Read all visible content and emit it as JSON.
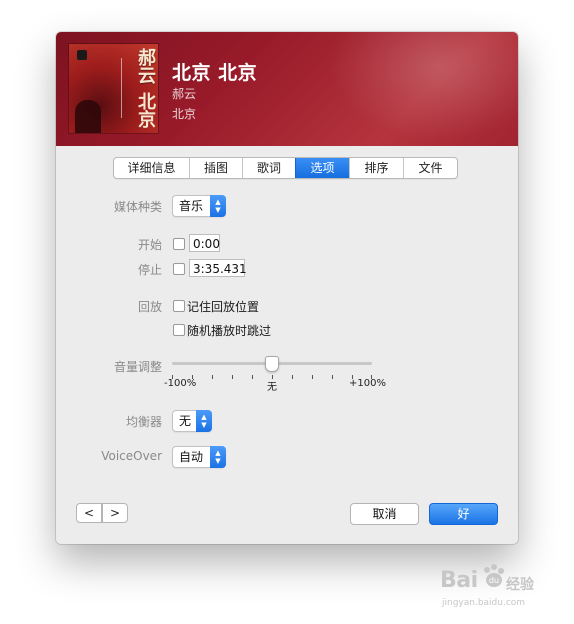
{
  "header": {
    "title": "北京 北京",
    "artist": "郝云",
    "album": "北京",
    "album_art": {
      "title_line1": "郝云",
      "title_line2": "北京"
    }
  },
  "tabs": [
    {
      "label": "详细信息",
      "active": false
    },
    {
      "label": "插图",
      "active": false
    },
    {
      "label": "歌词",
      "active": false
    },
    {
      "label": "选项",
      "active": true
    },
    {
      "label": "排序",
      "active": false
    },
    {
      "label": "文件",
      "active": false
    }
  ],
  "options": {
    "media_kind_label": "媒体种类",
    "media_kind_value": "音乐",
    "start_label": "开始",
    "start_checked": false,
    "start_value": "0:00",
    "stop_label": "停止",
    "stop_checked": false,
    "stop_value": "3:35.431",
    "playback_label": "回放",
    "remember_position_label": "记住回放位置",
    "remember_position_checked": false,
    "skip_shuffle_label": "随机播放时跳过",
    "skip_shuffle_checked": false,
    "volume_label": "音量调整",
    "volume_value_fraction": 0.5,
    "volume_min_label": "-100%",
    "volume_mid_label": "无",
    "volume_max_label": "+100%",
    "equalizer_label": "均衡器",
    "equalizer_value": "无",
    "voiceover_label": "VoiceOver",
    "voiceover_value": "自动"
  },
  "footer": {
    "prev_symbol": "<",
    "next_symbol": ">",
    "cancel_label": "取消",
    "ok_label": "好"
  },
  "watermark": {
    "main": "Bai",
    "paw": "du",
    "cn": "经验",
    "sub": "jingyan.baidu.com"
  },
  "colors": {
    "header_red": "#9a1b2a",
    "accent_blue": "#1a74e6"
  }
}
